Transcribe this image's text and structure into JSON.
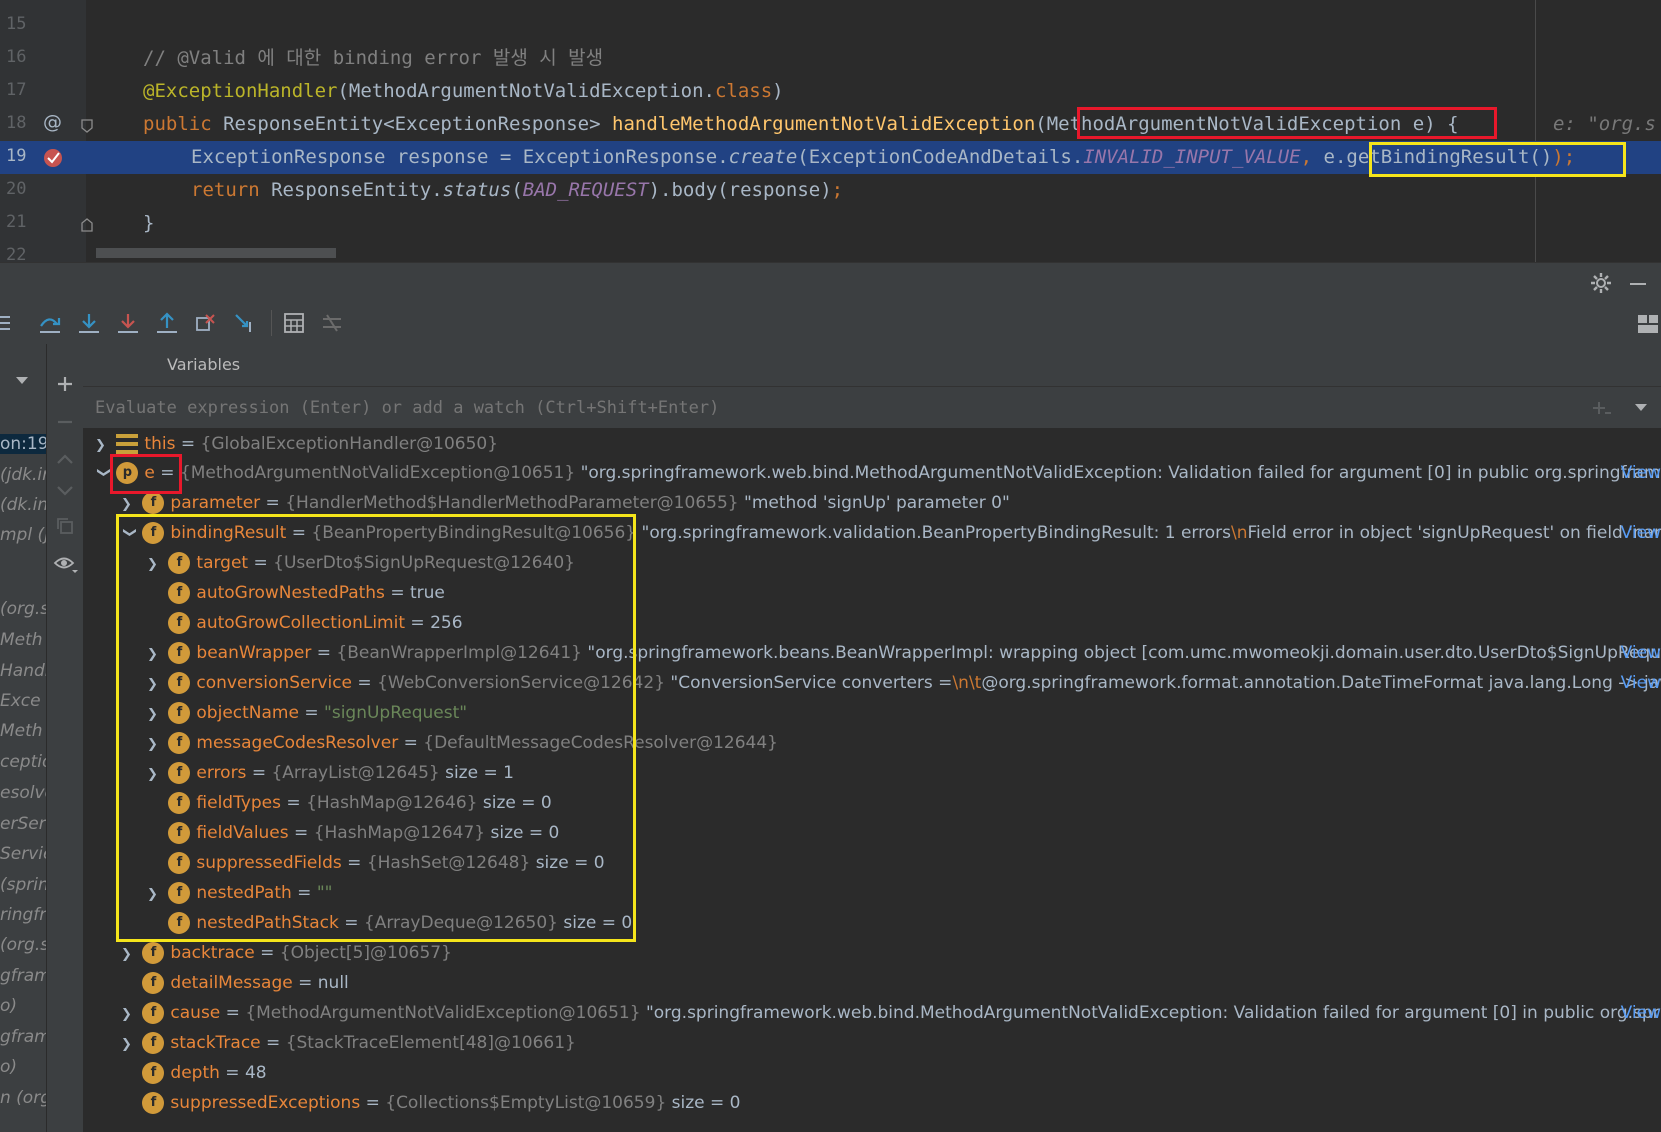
{
  "editor": {
    "lines": [
      {
        "n": "15"
      },
      {
        "n": "16",
        "comment": "// @Valid 에 대한 binding error 발생 시 발생"
      },
      {
        "n": "17",
        "annotation": "@ExceptionHandler",
        "ann_arg": "(MethodArgumentNotValidException.",
        "ann_kw": "class",
        "ann_end": ")"
      },
      {
        "n": "18",
        "kw": "public ",
        "type": "ResponseEntity<ExceptionResponse> ",
        "method": "handleMethodArgumentNotValidException",
        "params": "(MethodArgumentNotValidException e)",
        "brace": " {",
        "hint": "e: \"org.s"
      },
      {
        "n": "19",
        "p1": "ExceptionResponse response = ExceptionResponse.",
        "call": "create",
        "p2": "(ExceptionCodeAndDetails.",
        "const": "INVALID_INPUT_VALUE",
        "comma": ", ",
        "arg": "e.getBindingResult()",
        "end": ");"
      },
      {
        "n": "20",
        "kw": "return ",
        "p1": "ResponseEntity.",
        "call": "status",
        "p2": "(",
        "const": "BAD_REQUEST",
        "p3": ").body(response)",
        "semi": ";"
      },
      {
        "n": "21",
        "code": "}"
      },
      {
        "n": "22"
      }
    ],
    "gutter_icons": {
      "at": "@"
    }
  },
  "toolbar": {
    "icons": [
      "step-over-icon",
      "step-into-icon",
      "force-step-into-icon",
      "step-out-icon",
      "drop-frame-icon",
      "run-to-cursor-icon",
      "evaluate-icon",
      "trace-icon"
    ]
  },
  "frames": [
    "on:19,",
    "(jdk.in",
    "(dk.int",
    "mpl (jd",
    "(org.s",
    "Meth",
    "Handle",
    "Exce",
    "Meth",
    "ceptio",
    "esolve",
    "erSer",
    "Servie",
    "(spring",
    "ringfr",
    "(org.s",
    "gfram",
    "o)",
    "gfram",
    "o)",
    "n (org"
  ],
  "variables": {
    "title": "Variables",
    "placeholder": "Evaluate expression (Enter) or add a watch (Ctrl+Shift+Enter)",
    "view_label": "View",
    "rows": [
      {
        "name": "this",
        "eq": " = ",
        "type": "{GlobalExceptionHandler@10650}"
      },
      {
        "name": "e",
        "eq": " = ",
        "type": "{MethodArgumentNotValidException@10651}",
        "val": " \"org.springframework.web.bind.MethodArgumentNotValidException: Validation failed for argument [0] in public org.springframew..."
      },
      {
        "name": "parameter",
        "eq": " = ",
        "type": "{HandlerMethod$HandlerMethodParameter@10655}",
        "val": " \"method 'signUp' parameter 0\""
      },
      {
        "name": "bindingResult",
        "eq": " = ",
        "type": "{BeanPropertyBindingResult@10656}",
        "val": " \"org.springframework.validation.BeanPropertyBindingResult: 1 errors",
        "esc": "\\n",
        "val2": "Field error in object 'signUpRequest' on field 'name..."
      },
      {
        "name": "target",
        "eq": " = ",
        "type": "{UserDto$SignUpRequest@12640}"
      },
      {
        "name": "autoGrowNestedPaths",
        "eq": " = ",
        "val": "true"
      },
      {
        "name": "autoGrowCollectionLimit",
        "eq": " = ",
        "val": "256"
      },
      {
        "name": "beanWrapper",
        "eq": " = ",
        "type": "{BeanWrapperImpl@12641}",
        "val": " \"org.springframework.beans.BeanWrapperImpl: wrapping object [com.umc.mwomeokji.domain.user.dto.UserDto$SignUpRequest..."
      },
      {
        "name": "conversionService",
        "eq": " = ",
        "type": "{WebConversionService@12642}",
        "val": " \"ConversionService converters =",
        "esc": "\\n\\t",
        "val2": "@org.springframework.format.annotation.DateTimeFormat java.lang.Long -> java..."
      },
      {
        "name": "objectName",
        "eq": " = ",
        "str": "\"signUpRequest\""
      },
      {
        "name": "messageCodesResolver",
        "eq": " = ",
        "type": "{DefaultMessageCodesResolver@12644}"
      },
      {
        "name": "errors",
        "eq": " = ",
        "type": "{ArrayList@12645}",
        "val": "  size = 1"
      },
      {
        "name": "fieldTypes",
        "eq": " = ",
        "type": "{HashMap@12646}",
        "val": "  size = 0"
      },
      {
        "name": "fieldValues",
        "eq": " = ",
        "type": "{HashMap@12647}",
        "val": "  size = 0"
      },
      {
        "name": "suppressedFields",
        "eq": " = ",
        "type": "{HashSet@12648}",
        "val": "  size = 0"
      },
      {
        "name": "nestedPath",
        "eq": " = ",
        "str": "\"\""
      },
      {
        "name": "nestedPathStack",
        "eq": " = ",
        "type": "{ArrayDeque@12650}",
        "val": "  size = 0"
      },
      {
        "name": "backtrace",
        "eq": " = ",
        "type": "{Object[5]@10657}"
      },
      {
        "name": "detailMessage",
        "eq": " = ",
        "val": "null"
      },
      {
        "name": "cause",
        "eq": " = ",
        "type": "{MethodArgumentNotValidException@10651}",
        "val": " \"org.springframework.web.bind.MethodArgumentNotValidException: Validation failed for argument [0] in public org.spring..."
      },
      {
        "name": "stackTrace",
        "eq": " = ",
        "type": "{StackTraceElement[48]@10661}"
      },
      {
        "name": "depth",
        "eq": " = ",
        "val": "48"
      },
      {
        "name": "suppressedExceptions",
        "eq": " = ",
        "type": "{Collections$EmptyList@10659}",
        "val": "  size = 0"
      }
    ]
  },
  "colors": {
    "highlight_red": "#e8182b",
    "highlight_yellow": "#f5e51b",
    "selection": "#214283"
  }
}
